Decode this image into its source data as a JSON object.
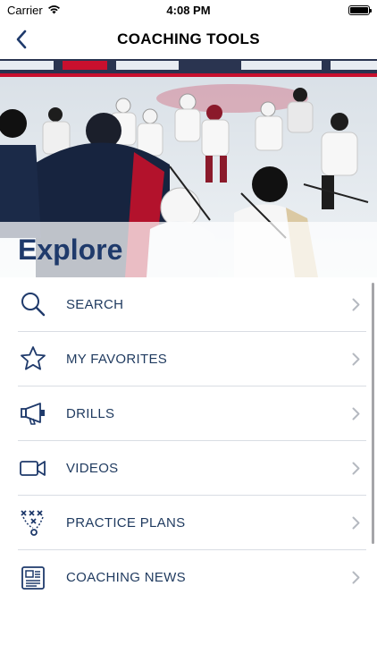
{
  "status_bar": {
    "carrier": "Carrier",
    "time": "4:08 PM"
  },
  "nav": {
    "title": "COACHING TOOLS"
  },
  "hero": {
    "heading": "Explore"
  },
  "menu": {
    "items": [
      {
        "label": "SEARCH",
        "icon": "search-icon"
      },
      {
        "label": "MY FAVORITES",
        "icon": "star-icon"
      },
      {
        "label": "DRILLS",
        "icon": "megaphone-icon"
      },
      {
        "label": "VIDEOS",
        "icon": "video-camera-icon"
      },
      {
        "label": "PRACTICE PLANS",
        "icon": "play-diagram-icon"
      },
      {
        "label": "COACHING NEWS",
        "icon": "newspaper-icon"
      }
    ]
  },
  "colors": {
    "accent": "#1f3a6b",
    "label": "#1f3a5f",
    "divider": "#d9dde3",
    "chevron": "#b5b9c0"
  }
}
